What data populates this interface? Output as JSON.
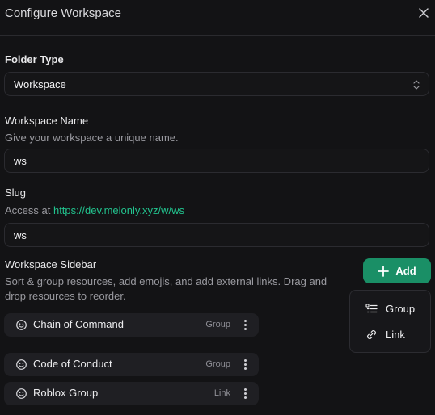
{
  "header": {
    "title": "Configure Workspace"
  },
  "folder_type": {
    "label": "Folder Type",
    "value": "Workspace"
  },
  "workspace_name": {
    "label": "Workspace Name",
    "description": "Give your workspace a unique name.",
    "value": "ws"
  },
  "slug": {
    "label": "Slug",
    "description_prefix": "Access at ",
    "url": "https://dev.melonly.xyz/w/ws",
    "value": "ws"
  },
  "sidebar": {
    "label": "Workspace Sidebar",
    "description": "Sort & group resources, add emojis, and add external links. Drag and drop resources to reorder.",
    "add_label": "Add",
    "menu": [
      {
        "label": "Group",
        "icon": "group-list-icon"
      },
      {
        "label": "Link",
        "icon": "link-icon"
      }
    ],
    "items": [
      {
        "name": "Chain of Command",
        "kind": "Group"
      },
      {
        "name": "Code of Conduct",
        "kind": "Group"
      },
      {
        "name": "Roblox Group",
        "kind": "Link"
      }
    ]
  },
  "colors": {
    "accent": "#1a8f66",
    "link": "#22c38e",
    "background": "#131315"
  }
}
